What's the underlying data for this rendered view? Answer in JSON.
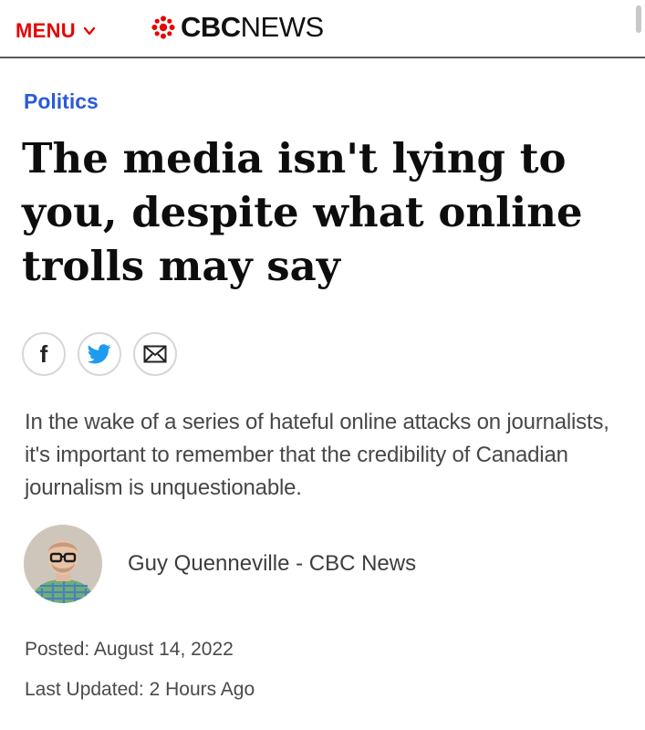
{
  "header": {
    "menu_label": "MENU",
    "brand_cbc": "CBC",
    "brand_news": "NEWS"
  },
  "article": {
    "category": "Politics",
    "headline": "The media isn't lying to you, despite what online trolls may say",
    "dek": "In the wake of a series of hateful online attacks on journalists, it's important to remember that the credibility of Canadian journalism is unquestionable.",
    "author": "Guy Quenneville - CBC News",
    "posted": "Posted: August 14, 2022",
    "updated": "Last Updated: 2 Hours Ago"
  },
  "share": {
    "facebook_glyph": "f",
    "icons": [
      "facebook-icon",
      "twitter-icon",
      "email-icon"
    ]
  },
  "colors": {
    "brand_red": "#e60505",
    "category_blue": "#2a5bd6",
    "twitter_blue": "#1d9bf0"
  }
}
